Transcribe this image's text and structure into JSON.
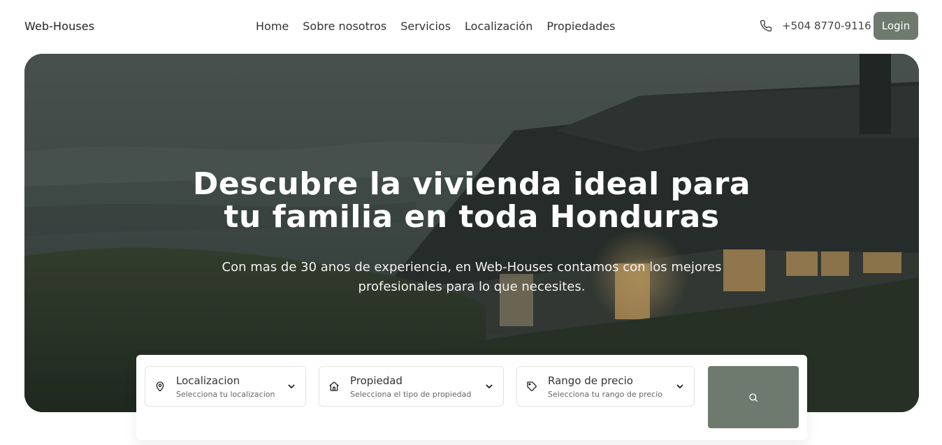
{
  "header": {
    "brand": "Web-Houses",
    "nav": [
      "Home",
      "Sobre nosotros",
      "Servicios",
      "Localización",
      "Propiedades"
    ],
    "phone_icon": "phone-icon",
    "phone": "+504 8770-9116",
    "login_label": "Login"
  },
  "hero": {
    "title_line1": "Descubre la vivienda ideal para",
    "title_line2": "tu familia en toda Honduras",
    "subtitle_line1": "Con mas de 30 anos de experiencia, en Web-Houses contamos con los mejores",
    "subtitle_line2": "profesionales para lo que necesites."
  },
  "search": {
    "fields": [
      {
        "icon": "map-pin-icon",
        "label": "Localizacion",
        "hint": "Selecciona tu localizacion"
      },
      {
        "icon": "house-icon",
        "label": "Propiedad",
        "hint": "Selecciona el tipo de propiedad"
      },
      {
        "icon": "price-tag-icon",
        "label": "Rango de precio",
        "hint": "Selecciona tu rango de precio"
      }
    ],
    "button_icon": "search-icon"
  },
  "colors": {
    "accent": "#6e7a6e",
    "hero_overlay": "#2f3a38"
  }
}
